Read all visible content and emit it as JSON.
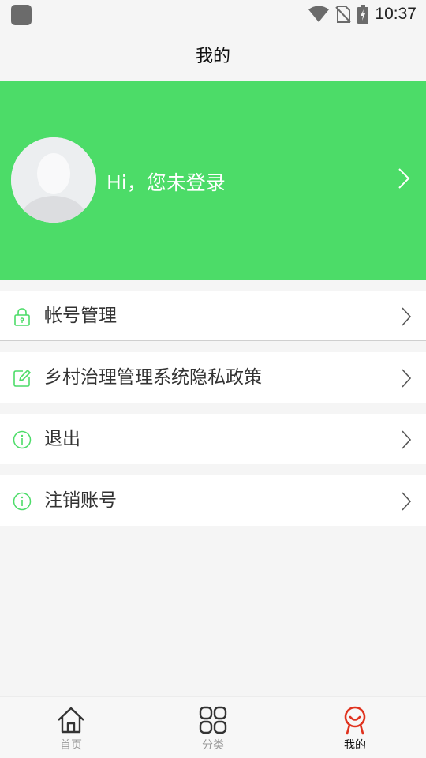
{
  "status_bar": {
    "time": "10:37"
  },
  "header": {
    "title": "我的"
  },
  "profile": {
    "greeting": "Hi，您未登录"
  },
  "menu": {
    "items": [
      {
        "label": "帐号管理",
        "icon": "lock-icon"
      },
      {
        "label": "乡村治理管理系统隐私政策",
        "icon": "edit-icon"
      },
      {
        "label": "退出",
        "icon": "info-icon"
      },
      {
        "label": "注销账号",
        "icon": "info-icon"
      }
    ]
  },
  "bottom_nav": {
    "items": [
      {
        "label": "首页",
        "icon": "home-icon"
      },
      {
        "label": "分类",
        "icon": "grid-icon"
      },
      {
        "label": "我的",
        "icon": "profile-icon",
        "active": true
      }
    ]
  },
  "colors": {
    "accent": "#4cdc68",
    "active_tab": "#e0321e",
    "background": "#f5f5f5"
  }
}
